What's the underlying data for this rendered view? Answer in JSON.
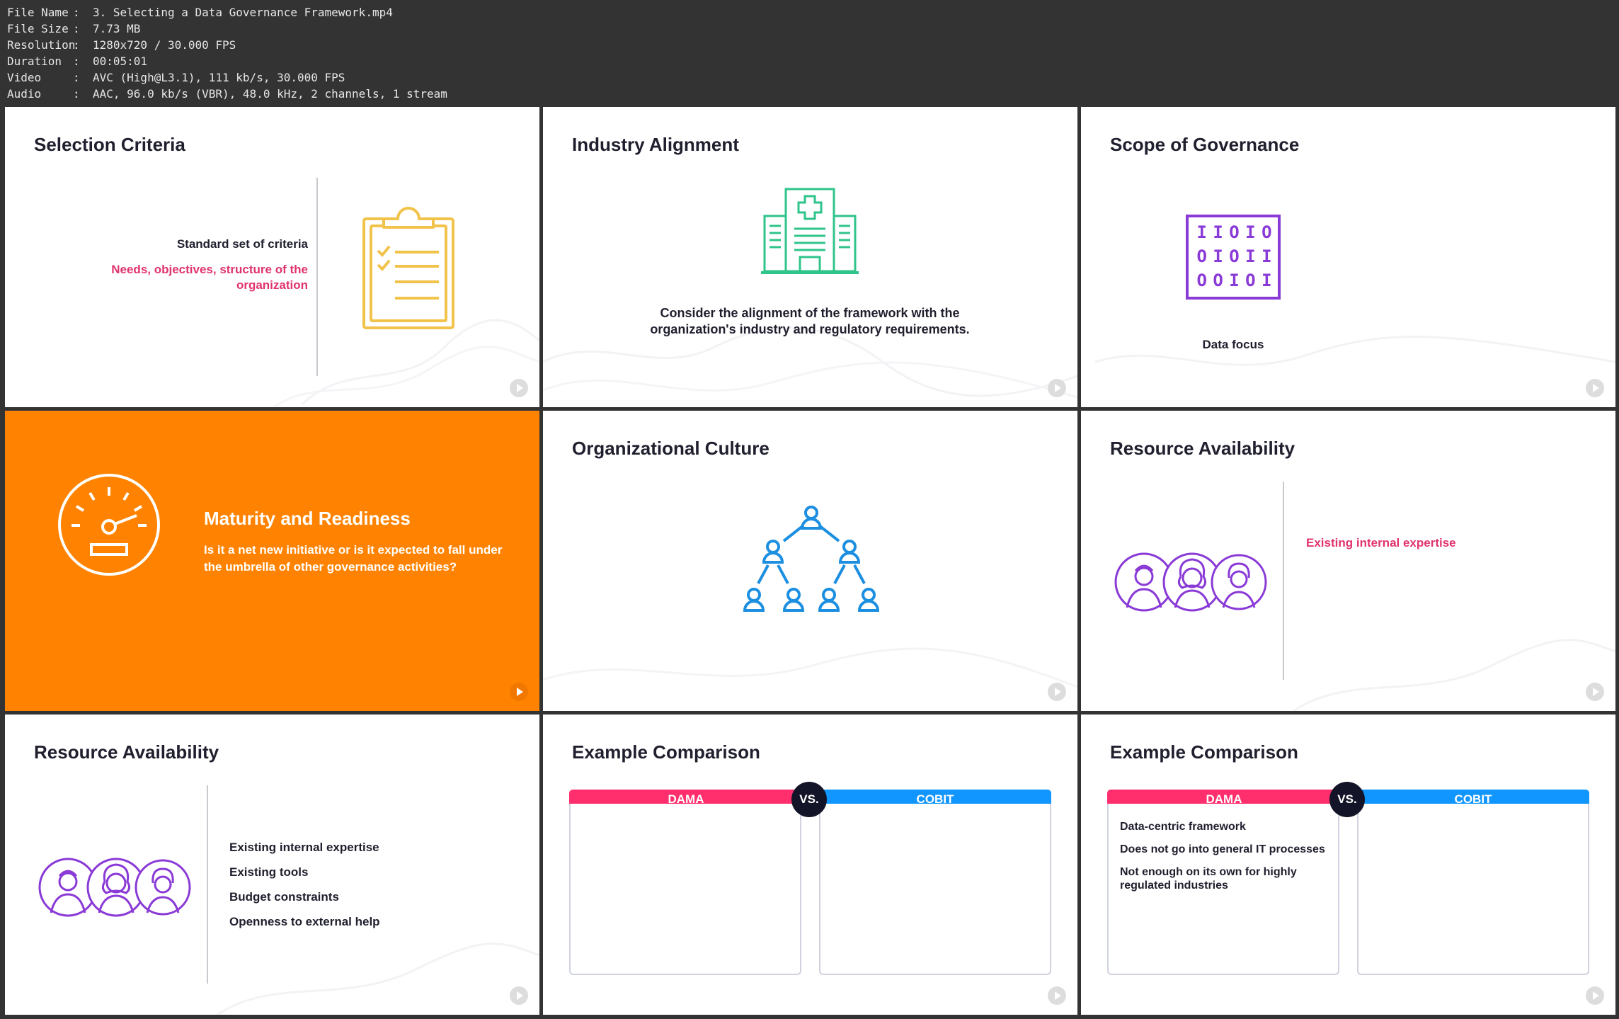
{
  "file_info": [
    {
      "key": "File Name",
      "value": "3. Selecting a Data Governance Framework.mp4"
    },
    {
      "key": "File Size",
      "value": "7.73 MB"
    },
    {
      "key": "Resolution",
      "value": "1280x720 / 30.000 FPS"
    },
    {
      "key": "Duration",
      "value": "00:05:01"
    },
    {
      "key": "Video",
      "value": "AVC (High@L3.1), 111 kb/s, 30.000 FPS"
    },
    {
      "key": "Audio",
      "value": "AAC, 96.0 kb/s (VBR), 48.0 kHz, 2 channels, 1 stream"
    }
  ],
  "tiles": {
    "selection": {
      "title": "Selection Criteria",
      "line1": "Standard set of criteria",
      "line2": "Needs, objectives, structure of the organization"
    },
    "industry": {
      "title": "Industry Alignment",
      "body": "Consider the alignment of the framework with the organization's industry and regulatory requirements."
    },
    "scope": {
      "title": "Scope of Governance",
      "binary": [
        "I I O I O",
        "O I O I I",
        "O O I O I"
      ],
      "caption": "Data focus"
    },
    "maturity": {
      "title": "Maturity and Readiness",
      "body": "Is it a net new initiative or is it expected to fall under the umbrella of other governance activities?"
    },
    "culture": {
      "title": "Organizational Culture"
    },
    "resource1": {
      "title": "Resource Availability",
      "item": "Existing internal expertise"
    },
    "resource2": {
      "title": "Resource Availability",
      "items": [
        "Existing internal expertise",
        "Existing tools",
        "Budget constraints",
        "Openness to external help"
      ]
    },
    "compare1": {
      "title": "Example Comparison",
      "left": "DAMA",
      "vs": "VS.",
      "right": "COBIT"
    },
    "compare2": {
      "title": "Example Comparison",
      "left": "DAMA",
      "vs": "VS.",
      "right": "COBIT",
      "left_items": [
        "Data-centric framework",
        "Does not go into general IT processes",
        "Not enough on its own for highly regulated industries"
      ]
    }
  },
  "colors": {
    "accent_pink": "#e0336d",
    "orange": "#ff8300",
    "clipboard_yellow": "#f2c34b",
    "hospital_green": "#2ec48a",
    "binary_purple": "#8a3ad6",
    "org_blue": "#1d8fe0",
    "dama_pink": "#ff2f6e",
    "cobit_blue": "#1196ff"
  }
}
